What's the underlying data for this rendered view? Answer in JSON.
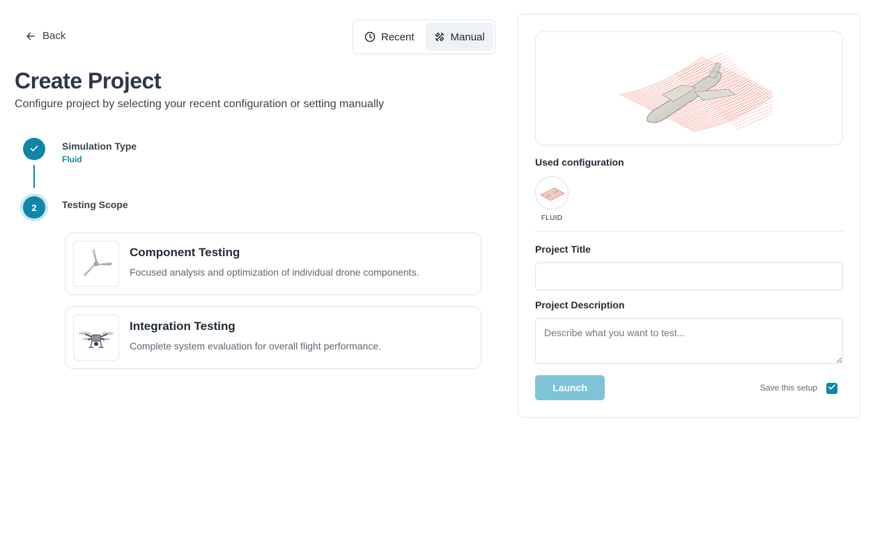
{
  "nav": {
    "back_label": "Back"
  },
  "mode_toggle": {
    "options": [
      {
        "label": "Recent",
        "icon": "clock-icon",
        "active": false
      },
      {
        "label": "Manual",
        "icon": "tools-icon",
        "active": true
      }
    ]
  },
  "header": {
    "title": "Create Project",
    "subtitle": "Configure project by selecting your recent configuration or setting manually"
  },
  "steps": [
    {
      "title": "Simulation Type",
      "value": "Fluid",
      "status": "complete",
      "icon": "check-icon"
    },
    {
      "title": "Testing Scope",
      "number": "2",
      "status": "current"
    }
  ],
  "testing_options": [
    {
      "title": "Component Testing",
      "description": "Focused analysis and optimization of individual drone components.",
      "icon": "propeller-icon"
    },
    {
      "title": "Integration Testing",
      "description": "Complete system evaluation for overall flight performance.",
      "icon": "drone-icon"
    }
  ],
  "panel": {
    "preview_icon": "aircraft-airflow-preview",
    "used_config_label": "Used configuration",
    "config_chip": {
      "label": "FLUID",
      "icon": "aircraft-thumbnail-icon"
    },
    "project_title_label": "Project Title",
    "project_title_value": "",
    "project_description_label": "Project Description",
    "project_description_placeholder": "Describe what you want to test...",
    "launch_label": "Launch",
    "save_setup_label": "Save this setup",
    "save_setup_checked": true
  },
  "colors": {
    "accent": "#0e87a6",
    "accent_light": "#7ec4d6",
    "text_dark": "#2d3748",
    "border": "#dfe3e8",
    "streamline": "#e8604c"
  }
}
